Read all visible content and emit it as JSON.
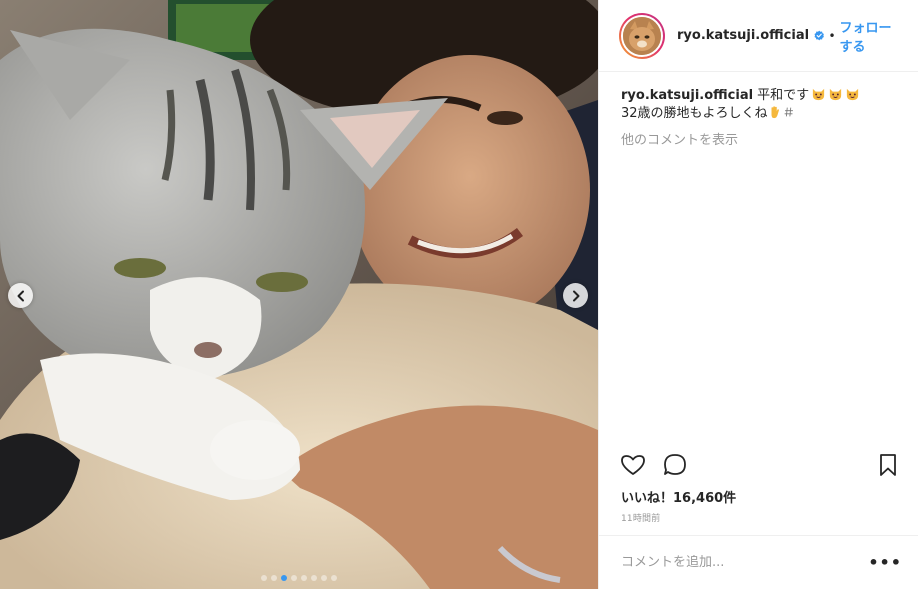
{
  "post": {
    "username": "ryo.katsuji.official",
    "follow_label": "フォローする",
    "bullet": "•",
    "caption": {
      "username": "ryo.katsuji.official",
      "line1": "平和です",
      "line2": "32歳の勝地もよろしくね",
      "line1_emojis": [
        "cat-face-emoji",
        "cat-face-emoji",
        "cat-face-emoji"
      ],
      "line2_emojis": [
        "raised-hand-emoji",
        "hashtag-glyph"
      ]
    },
    "view_comments": "他のコメントを表示",
    "likes": "いいね！16,460件",
    "time_ago": "11時間前",
    "comment_placeholder": "コメントを追加...",
    "more_options": "•••",
    "carousel": {
      "total": 8,
      "active": 2
    }
  },
  "colors": {
    "link": "#3897f0",
    "text": "#262626",
    "muted": "#999999",
    "divider": "#efefef"
  }
}
